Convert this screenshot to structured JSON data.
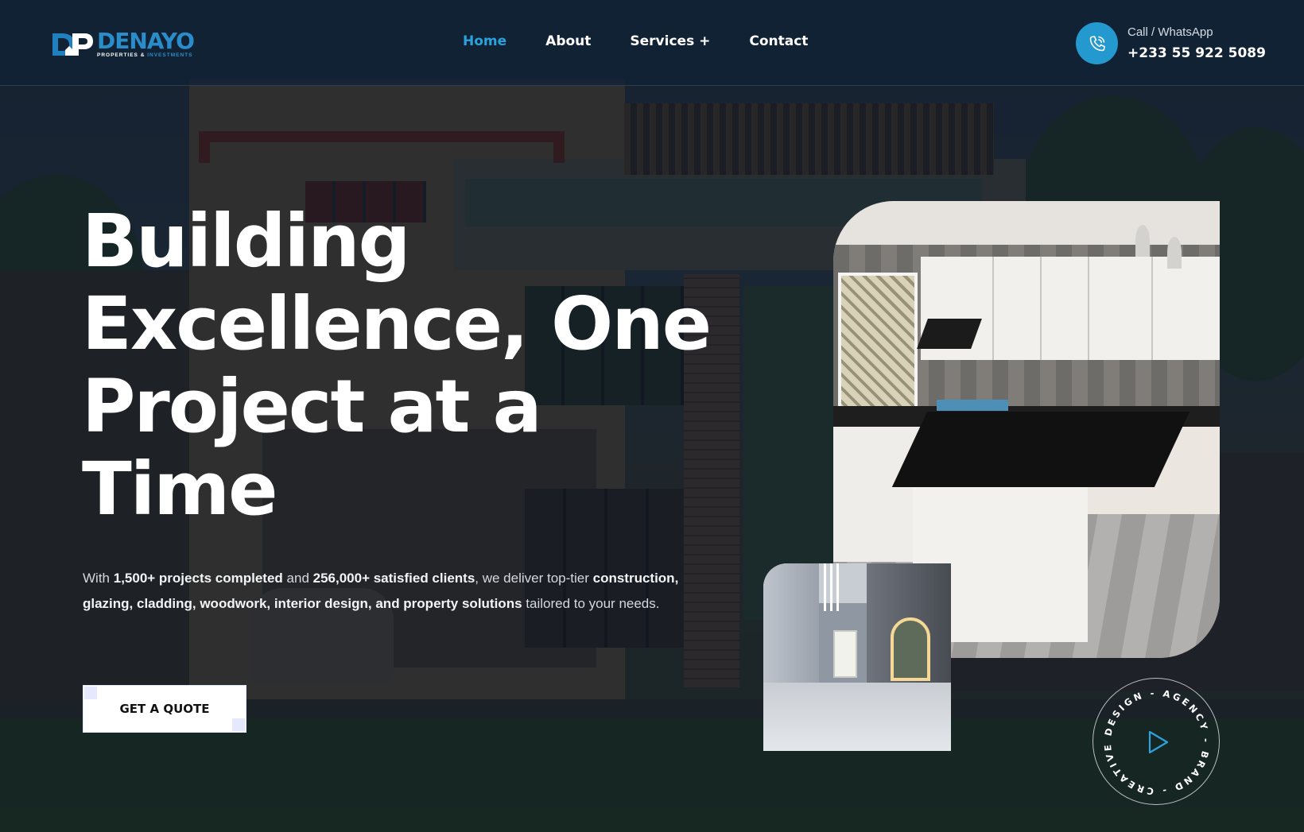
{
  "brand": {
    "name": "DENAYO",
    "tagline_part1": "PROPERTIES & ",
    "tagline_part2": "INVESTMENTS",
    "logo_initials": "DP"
  },
  "nav": {
    "items": [
      {
        "label": "Home",
        "active": true
      },
      {
        "label": "About",
        "active": false
      },
      {
        "label": "Services +",
        "active": false
      },
      {
        "label": "Contact",
        "active": false
      }
    ]
  },
  "contact": {
    "label": "Call / WhatsApp",
    "number": "+233 55 922 5089",
    "icon": "phone-icon"
  },
  "hero": {
    "headline_lines": [
      "Building",
      "Excellence, One",
      "Project at a",
      "Time"
    ],
    "desc": {
      "p1": "With ",
      "b1": "1,500+ projects completed",
      "p2": " and ",
      "b2": "256,000+ satisfied clients",
      "p3": ", we deliver top-tier ",
      "b3": "construction, glazing, cladding, woodwork, interior design, and property solutions",
      "p4": " tailored to your needs."
    },
    "cta_label": "GET A QUOTE"
  },
  "badge": {
    "circular_text": "DESIGN - AGENCY - BRAND - CREATIVE - ",
    "icon": "play-icon"
  },
  "colors": {
    "accent": "#2399cf",
    "nav_active": "#2aa3dc",
    "header_bg": "#122236"
  }
}
